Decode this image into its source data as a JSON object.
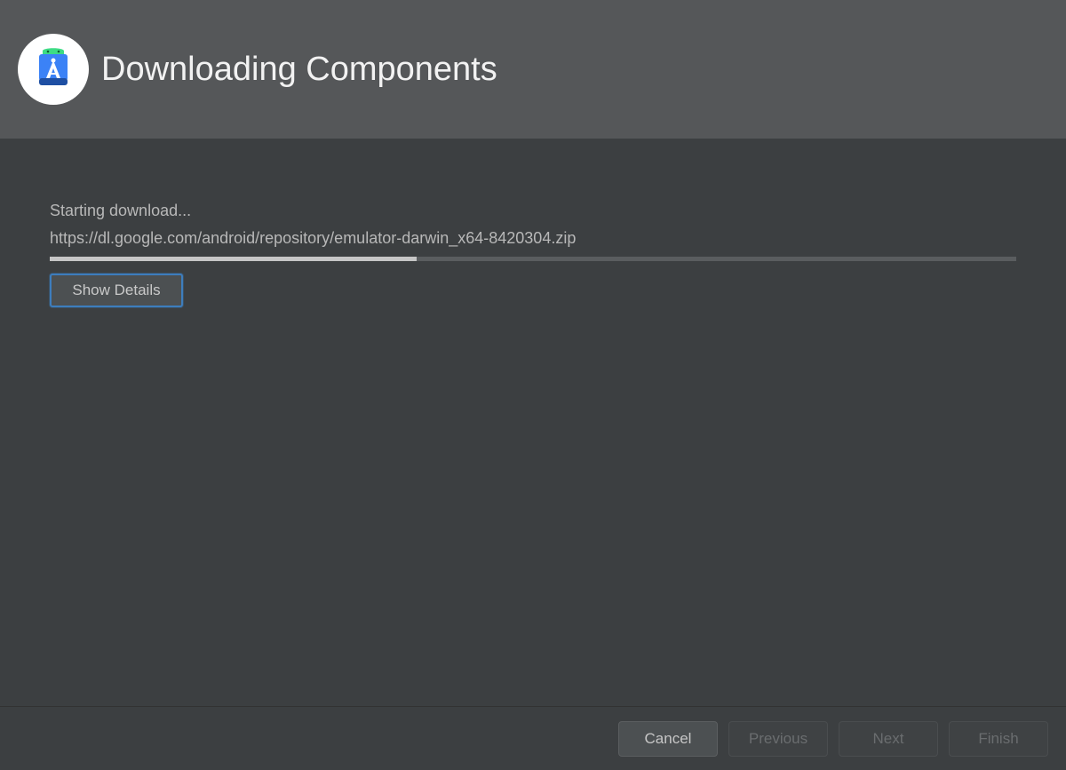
{
  "header": {
    "title": "Downloading Components"
  },
  "content": {
    "status_label": "Starting download...",
    "download_url": "https://dl.google.com/android/repository/emulator-darwin_x64-8420304.zip",
    "progress_percent": 38,
    "show_details_label": "Show Details"
  },
  "footer": {
    "cancel_label": "Cancel",
    "previous_label": "Previous",
    "next_label": "Next",
    "finish_label": "Finish"
  },
  "colors": {
    "header_bg": "#555759",
    "body_bg": "#3c3f41",
    "accent": "#3d7dbd"
  }
}
